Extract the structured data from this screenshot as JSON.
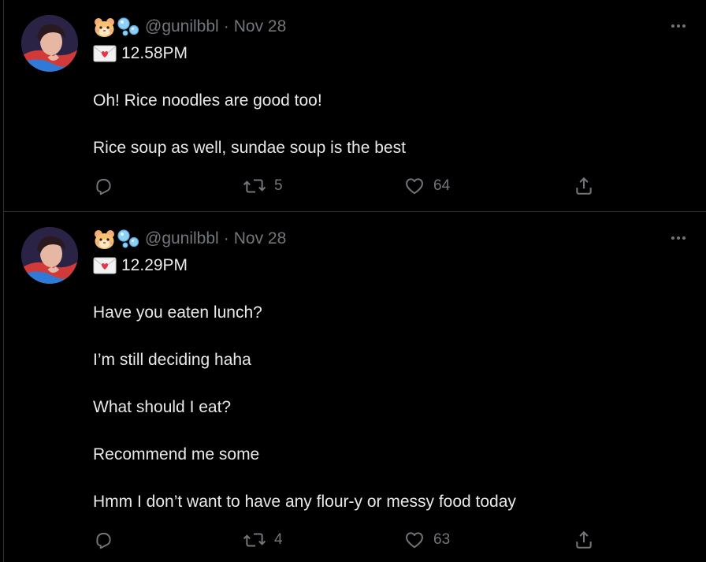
{
  "tweets": [
    {
      "handle": "@gunilbbl",
      "separator": "·",
      "date": "Nov 28",
      "time": "12.58PM",
      "lines": [
        "Oh! Rice noodles are good too!",
        "Rice soup as well, sundae soup is the best"
      ],
      "retweets": "5",
      "likes": "64",
      "icons": {
        "name_emojis": [
          "hamster-face-icon",
          "bubbles-icon"
        ],
        "time_prefix": "love-letter-icon",
        "more": "more-icon",
        "reply": "reply-icon",
        "retweet": "retweet-icon",
        "like": "heart-icon",
        "share": "share-icon"
      }
    },
    {
      "handle": "@gunilbbl",
      "separator": "·",
      "date": "Nov 28",
      "time": "12.29PM",
      "lines": [
        "Have you eaten lunch?",
        "I’m still deciding haha",
        "What should I eat?",
        "Recommend me some",
        "Hmm I don’t want to have any flour-y or messy food today"
      ],
      "retweets": "4",
      "likes": "63",
      "icons": {
        "name_emojis": [
          "hamster-face-icon",
          "bubbles-icon"
        ],
        "time_prefix": "love-letter-icon",
        "more": "more-icon",
        "reply": "reply-icon",
        "retweet": "retweet-icon",
        "like": "heart-icon",
        "share": "share-icon"
      }
    }
  ],
  "colors": {
    "background": "#000000",
    "text_primary": "#e7e9ea",
    "text_secondary": "#71767b",
    "divider": "#2f3336"
  }
}
